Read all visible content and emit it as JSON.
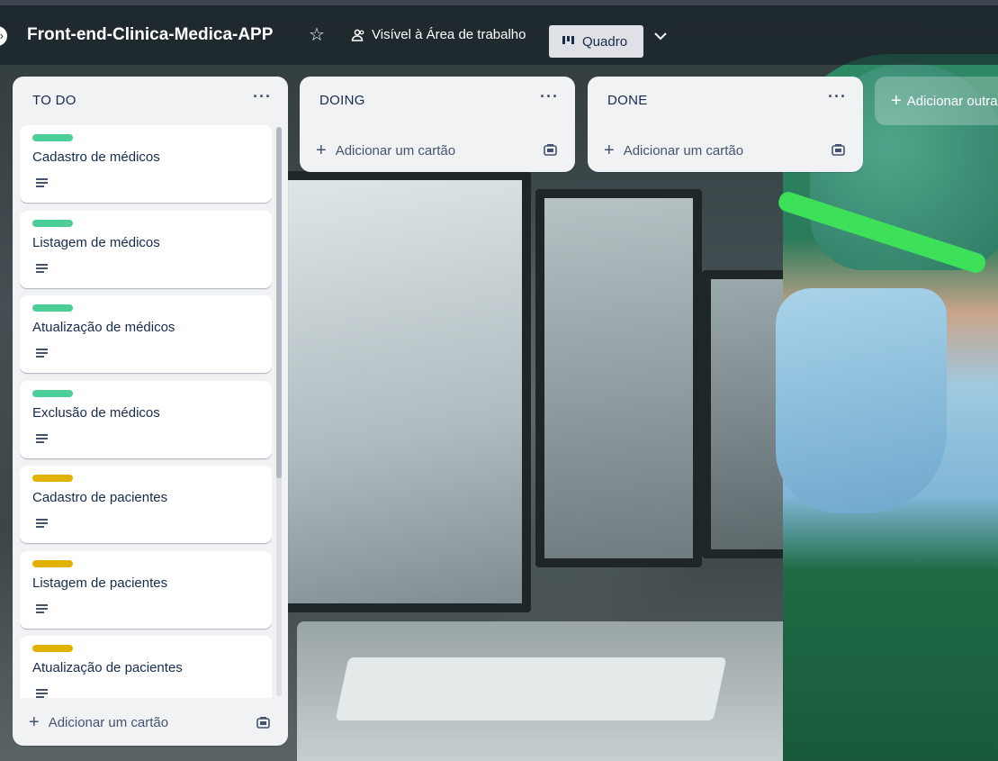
{
  "header": {
    "board_title": "Front-end-Clinica-Medica-APP",
    "visibility": "Visível à Área de trabalho",
    "view": "Quadro"
  },
  "colors": {
    "label_green": "#4bce97",
    "label_yellow": "#e2b203",
    "list_bg": "#f1f2f4",
    "header_bg": "rgba(20,30,36,0.62)"
  },
  "lists": {
    "todo": {
      "title": "TO DO",
      "add_card": "Adicionar um cartão",
      "cards": [
        {
          "title": "Cadastro de médicos",
          "label_color": "green"
        },
        {
          "title": "Listagem de médicos",
          "label_color": "green"
        },
        {
          "title": "Atualização de médicos",
          "label_color": "green"
        },
        {
          "title": "Exclusão de médicos",
          "label_color": "green"
        },
        {
          "title": "Cadastro de pacientes",
          "label_color": "yellow"
        },
        {
          "title": "Listagem de pacientes",
          "label_color": "yellow"
        },
        {
          "title": "Atualização de pacientes",
          "label_color": "yellow"
        }
      ]
    },
    "doing": {
      "title": "DOING",
      "add_card": "Adicionar um cartão"
    },
    "done": {
      "title": "DONE",
      "add_card": "Adicionar um cartão"
    }
  },
  "add_list": "Adicionar outra lista"
}
